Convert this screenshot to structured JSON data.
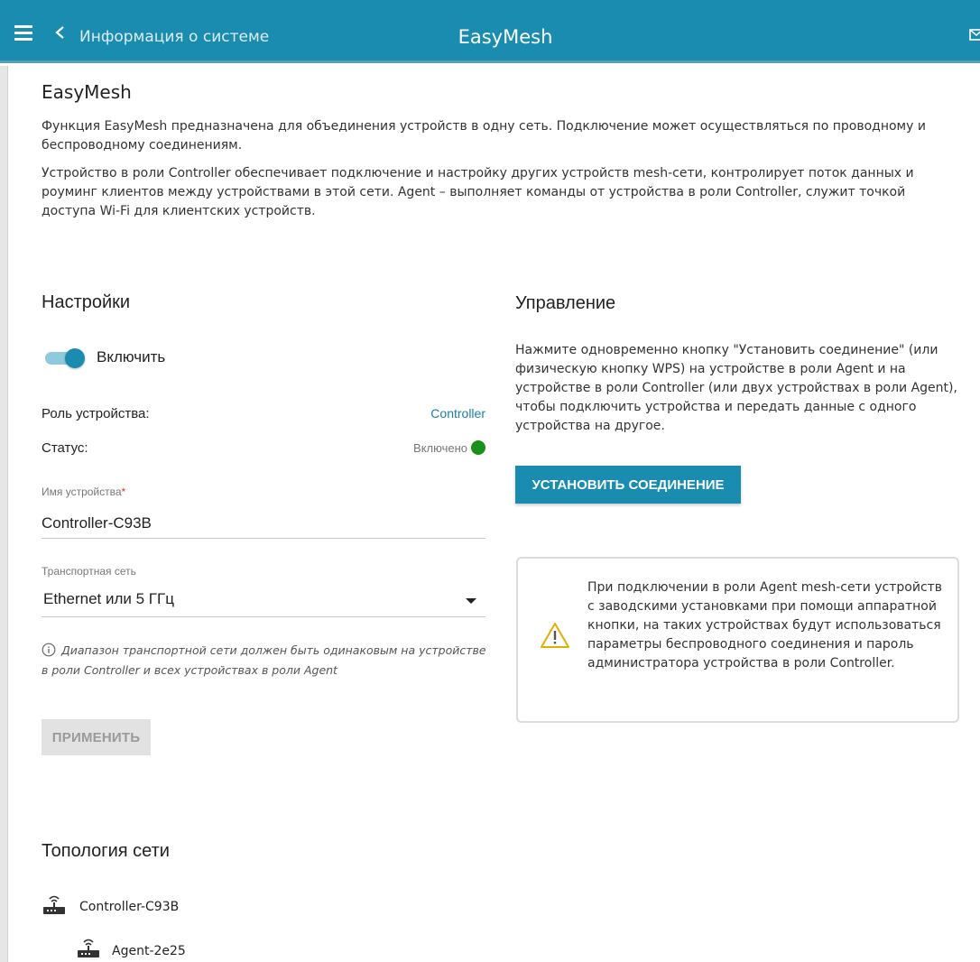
{
  "header": {
    "back_label": "Информация о системе",
    "title": "EasyMesh"
  },
  "page": {
    "heading": "EasyMesh",
    "paragraph1": "Функция EasyMesh предназначена для объединения устройств в одну сеть. Подключение может осуществляться по проводному и беспроводному соединениям.",
    "paragraph2": "Устройство в роли Controller обеспечивает подключение и настройку других устройств mesh-сети, контролирует поток данных и роуминг клиентов между устройствами в этой сети. Agent – выполняет команды от устройства в роли Controller, служит точкой доступа Wi-Fi для клиентских устройств."
  },
  "settings": {
    "heading": "Настройки",
    "enable_label": "Включить",
    "enabled": true,
    "role_label": "Роль устройства:",
    "role_value": "Controller",
    "status_label": "Статус:",
    "status_value": "Включено",
    "status_color": "#1a8f1a",
    "device_name_caption": "Имя устройства",
    "required_mark": "*",
    "device_name_value": "Controller-C93B",
    "transport_caption": "Транспортная сеть",
    "transport_value": "Ethernet или 5 ГГц",
    "hint": "Диапазон транспортной сети должен быть одинаковым на устройстве в роли Controller и всех устройствах в роли Agent",
    "apply_label": "ПРИМЕНИТЬ"
  },
  "management": {
    "heading": "Управление",
    "text": "Нажмите одновременно кнопку \"Установить соединение\" (или физическую кнопку WPS) на устройстве в роли Agent и на устройстве в роли Controller (или двух устройствах в роли Agent), чтобы подключить устройства и передать данные с одного устройства на другое.",
    "connect_label": "УСТАНОВИТЬ СОЕДИНЕНИЕ",
    "warning_text": "При подключении в роли Agent mesh-сети устройств с заводскими установками при помощи аппаратной кнопки, на таких устройствах будут использоваться параметры беспроводного соединения и пароль администратора устройства в роли Controller."
  },
  "topology": {
    "heading": "Топология сети",
    "nodes": [
      {
        "label": "Controller-C93B",
        "icon": "router-icon"
      },
      {
        "label": "Agent-2e25",
        "icon": "router-icon"
      }
    ]
  },
  "colors": {
    "accent": "#1a8caf",
    "warning": "#e0b000"
  }
}
